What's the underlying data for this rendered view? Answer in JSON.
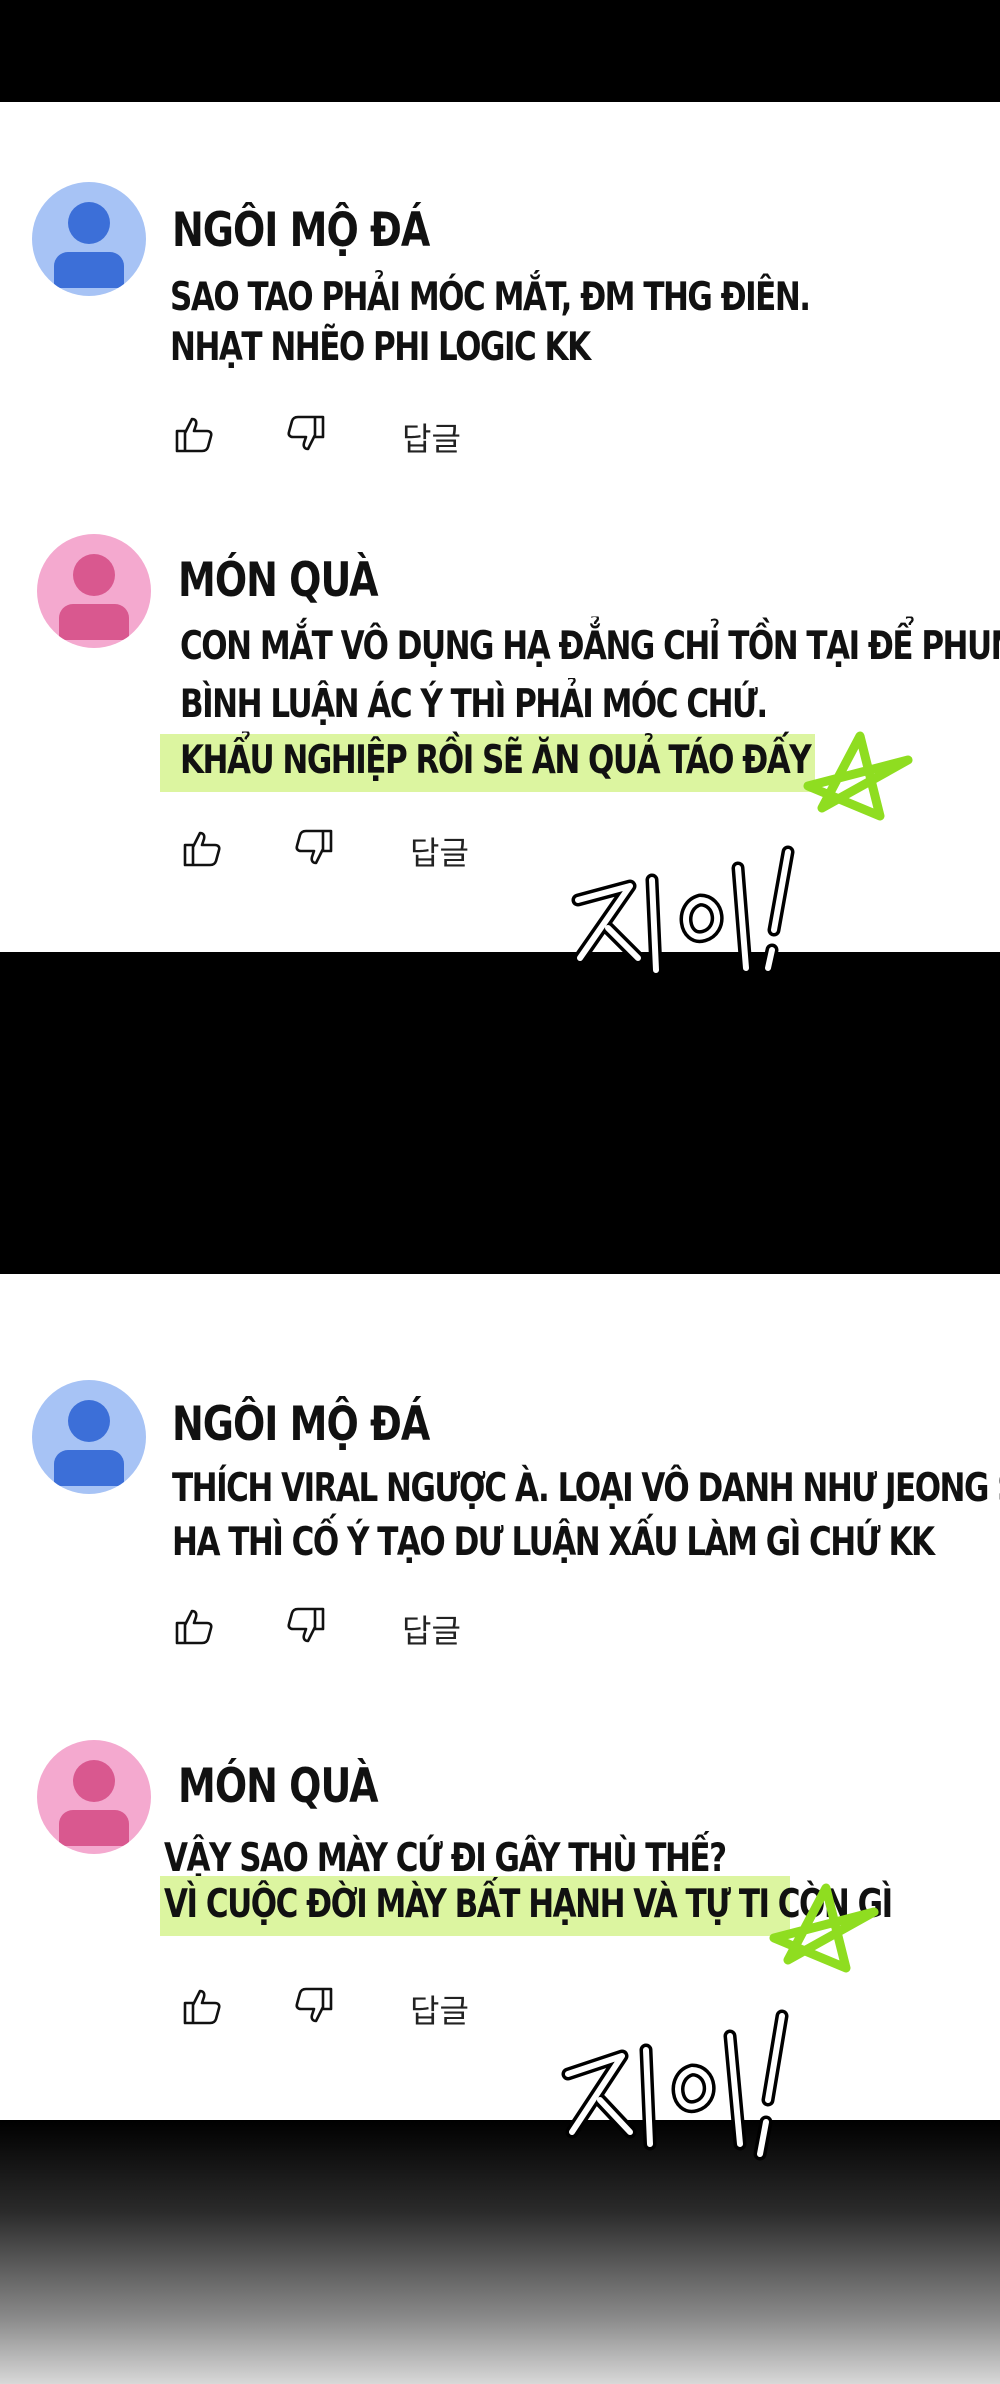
{
  "comments": [
    {
      "author": "NGÔI MỘ ĐÁ",
      "lines": [
        "SAO TAO PHẢI MÓC MẮT, ĐM THG ĐIÊN.",
        "NHẠT NHẼO PHI LOGIC KK"
      ],
      "reply_label": "답글",
      "avatar_color": "#3c6fd8"
    },
    {
      "author": "MÓN QUÀ",
      "lines": [
        "CON MẮT VÔ DỤNG HẠ ĐẲNG CHỈ TỒN TẠI ĐỂ PHUN",
        "BÌNH LUẬN ÁC Ý THÌ PHẢI MÓC CHỨ.",
        "KHẨU NGHIỆP RỒI SẼ ĂN QUẢ TÁO ĐẤY"
      ],
      "reply_label": "답글",
      "avatar_color": "#d9588f",
      "sfx": "지이잉"
    },
    {
      "author": "NGÔI MỘ ĐÁ",
      "lines": [
        "THÍCH VIRAL NGƯỢC À. LOẠI VÔ DANH NHƯ JEONG SU",
        "HA THÌ CỐ Ý TẠO DƯ LUẬN XẤU LÀM GÌ CHỨ KK"
      ],
      "reply_label": "답글",
      "avatar_color": "#3c6fd8"
    },
    {
      "author": "MÓN QUÀ",
      "lines": [
        "VẬY SAO MÀY CỨ ĐI GÂY THÙ THẾ?",
        "VÌ CUỘC ĐỜI MÀY BẤT HẠNH VÀ TỰ TI CÒN GÌ"
      ],
      "reply_label": "답글",
      "avatar_color": "#d9588f",
      "sfx": "지이잉"
    }
  ],
  "icons": [
    "thumbs-up-icon",
    "thumbs-down-icon"
  ],
  "highlight_color": "#dcf5a0",
  "star_color": "#8fdd20"
}
